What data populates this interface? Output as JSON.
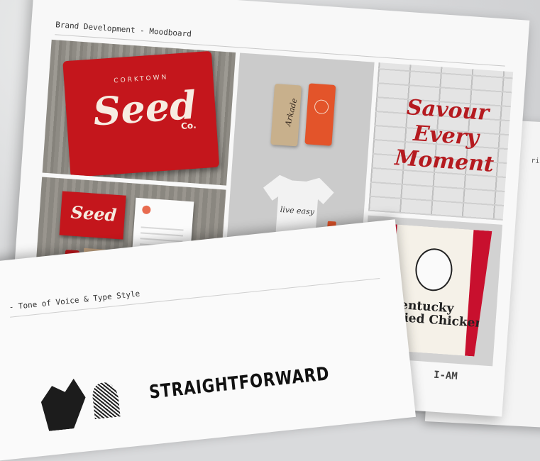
{
  "back_sheet": {
    "title_fragment": "ri"
  },
  "moodboard": {
    "title": "Brand Development - Moodboard",
    "tiles": {
      "seed_tee": {
        "small_text": "CORKTOWN",
        "big_text": "Seed",
        "suffix": "Co."
      },
      "tags": {
        "tag_text": "Arkade",
        "shirt_text": "live easy"
      },
      "wall": {
        "line1": "Savour",
        "line2": "Every",
        "line3": "Moment"
      },
      "stationery": {
        "card_text": "Seed"
      },
      "bucket": {
        "line1": "Kentucky",
        "line2": "Fried Chicken"
      }
    },
    "logo": "I-AM"
  },
  "front_sheet": {
    "title": "- Tone of Voice & Type Style",
    "headline": "STRAIGHTFORWARD"
  },
  "colors": {
    "brand_red": "#c4161c",
    "orange": "#e3542a",
    "paper": "#f8f8f8"
  }
}
